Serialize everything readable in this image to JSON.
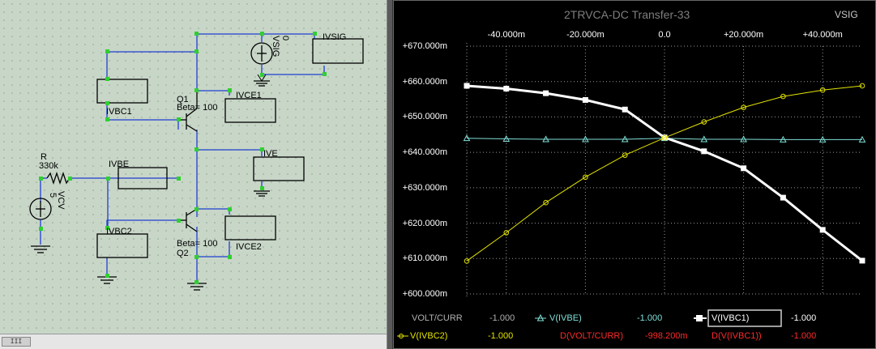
{
  "schematic": {
    "labels": {
      "vsig": "VSIG",
      "vsig_value": "0",
      "ivsig": "IVSIG",
      "ivbc1": "IVBC1",
      "q1": "Q1",
      "beta1": "Beta= 100",
      "ivce1": "IVCE1",
      "ive": "IVE",
      "ivbe": "IVBE",
      "r": "R",
      "r_value": "330k",
      "vcv": "VCV",
      "vcv_value": "5",
      "ivbc2": "IVBC2",
      "beta2": "Beta= 100",
      "q2": "Q2",
      "ivce2": "IVCE2"
    },
    "scrollbar_thumb": "III"
  },
  "plot": {
    "title": "2TRVCA-DC Transfer-33",
    "x_variable": "VSIG",
    "colors": {
      "grid": "#9a9a9a",
      "ivbe": "#7fe0d8",
      "ivbc1": "#ffffff",
      "ivbc2": "#e4e400",
      "legend_red": "#ff2a2a",
      "legend_gray": "#b0b0b0"
    },
    "legend": {
      "row1": [
        {
          "label": "VOLT/CURR",
          "value": "-1.000",
          "color": "#b0b0b0"
        },
        {
          "label": "V(IVBE)",
          "value": "-1.000",
          "color": "#7fe0d8"
        },
        {
          "label": "V(IVBC1)",
          "value": "-1.000",
          "color": "#ffffff"
        }
      ],
      "row2": [
        {
          "label": "V(IVBC2)",
          "value": "-1.000",
          "color": "#e4e400"
        },
        {
          "label": "D(VOLT/CURR)",
          "value": "-998.200m",
          "color": "#ff2a2a"
        },
        {
          "label": "D(V(IVBC1))",
          "value": "-1.000",
          "color": "#ff2a2a"
        }
      ]
    }
  },
  "chart_data": {
    "type": "line",
    "title": "2TRVCA-DC Transfer-33",
    "xlabel": "VSIG",
    "ylabel": "",
    "xlim": [
      -0.05,
      0.05
    ],
    "ylim": [
      0.6,
      0.67
    ],
    "x_ticks": [
      {
        "value": -0.04,
        "label": "-40.000m"
      },
      {
        "value": -0.02,
        "label": "-20.000m"
      },
      {
        "value": 0,
        "label": "0.0"
      },
      {
        "value": 0.02,
        "label": "+20.000m"
      },
      {
        "value": 0.04,
        "label": "+40.000m"
      }
    ],
    "y_ticks": [
      {
        "value": 0.67,
        "label": "+670.000m"
      },
      {
        "value": 0.66,
        "label": "+660.000m"
      },
      {
        "value": 0.65,
        "label": "+650.000m"
      },
      {
        "value": 0.64,
        "label": "+640.000m"
      },
      {
        "value": 0.63,
        "label": "+630.000m"
      },
      {
        "value": 0.62,
        "label": "+620.000m"
      },
      {
        "value": 0.61,
        "label": "+610.000m"
      },
      {
        "value": 0.6,
        "label": "+600.000m"
      }
    ],
    "grid": true,
    "series": [
      {
        "name": "V(IVBE)",
        "color": "#7fe0d8",
        "marker": "triangle",
        "x": [
          -0.05,
          -0.04,
          -0.03,
          -0.02,
          -0.01,
          0,
          0.01,
          0.02,
          0.03,
          0.04,
          0.05
        ],
        "values": [
          0.644,
          0.6438,
          0.6437,
          0.6437,
          0.6437,
          0.644,
          0.6437,
          0.6437,
          0.6436,
          0.6436,
          0.6436
        ]
      },
      {
        "name": "V(IVBC1)",
        "color": "#ffffff",
        "marker": "square",
        "x": [
          -0.05,
          -0.04,
          -0.03,
          -0.02,
          -0.01,
          0,
          0.01,
          0.02,
          0.03,
          0.04,
          0.05
        ],
        "values": [
          0.6588,
          0.658,
          0.6567,
          0.6548,
          0.6521,
          0.6442,
          0.6403,
          0.6355,
          0.6272,
          0.6181,
          0.6094
        ]
      },
      {
        "name": "V(IVBC2)",
        "color": "#e4e400",
        "marker": "circle",
        "x": [
          -0.05,
          -0.04,
          -0.03,
          -0.02,
          -0.01,
          0,
          0.01,
          0.02,
          0.03,
          0.04,
          0.05
        ],
        "values": [
          0.6093,
          0.6173,
          0.6258,
          0.633,
          0.6392,
          0.6441,
          0.6486,
          0.6527,
          0.6558,
          0.6576,
          0.6588
        ]
      }
    ]
  }
}
